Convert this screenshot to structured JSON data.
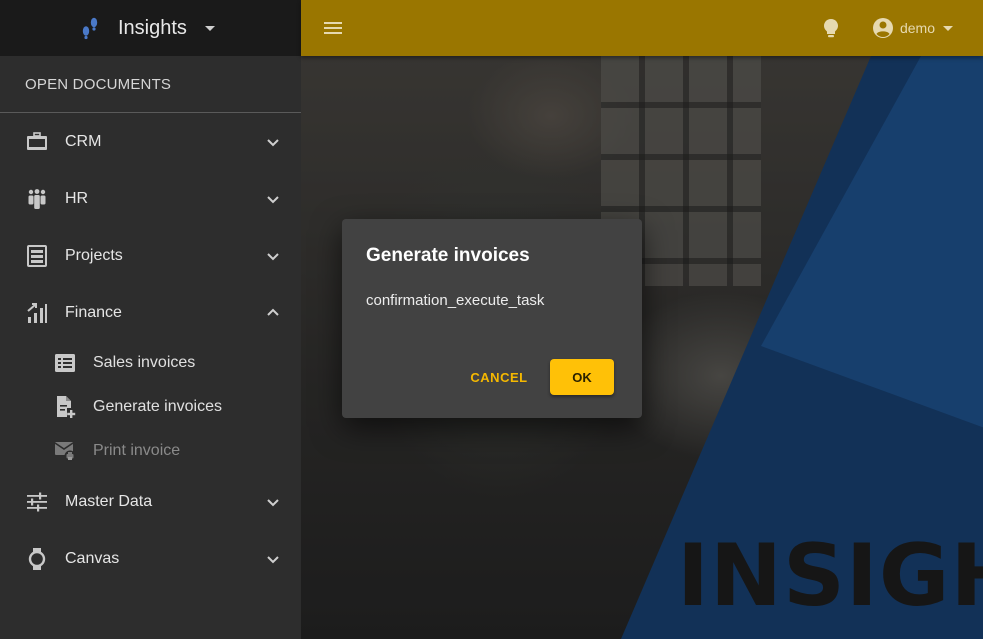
{
  "app": {
    "title": "Insights",
    "brand_text": "INSIGH"
  },
  "sidebar": {
    "section_title": "OPEN DOCUMENTS",
    "items": [
      {
        "label": "CRM",
        "icon": "briefcase-icon",
        "expanded": false
      },
      {
        "label": "HR",
        "icon": "people-icon",
        "expanded": false
      },
      {
        "label": "Projects",
        "icon": "projects-icon",
        "expanded": false
      },
      {
        "label": "Finance",
        "icon": "finance-icon",
        "expanded": true
      },
      {
        "label": "Master Data",
        "icon": "sliders-icon",
        "expanded": false
      },
      {
        "label": "Canvas",
        "icon": "watch-icon",
        "expanded": false
      }
    ],
    "finance_children": [
      {
        "label": "Sales invoices",
        "icon": "list-icon",
        "disabled": false
      },
      {
        "label": "Generate invoices",
        "icon": "file-add-icon",
        "disabled": false
      },
      {
        "label": "Print invoice",
        "icon": "mail-print-icon",
        "disabled": true
      }
    ]
  },
  "topbar": {
    "user": "demo",
    "accent": "#9a7600"
  },
  "dialog": {
    "title": "Generate invoices",
    "message": "confirmation_execute_task",
    "cancel_label": "CANCEL",
    "ok_label": "OK",
    "accent": "#ffc107"
  }
}
